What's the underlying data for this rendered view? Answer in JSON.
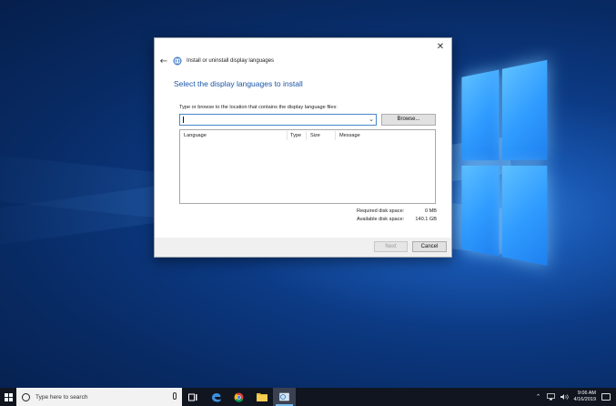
{
  "dialog": {
    "title": "Install or uninstall display languages",
    "heading": "Select the display languages to install",
    "path_label": "Type or browse to the location that contains the display language files:",
    "path_value": "",
    "browse_label": "Browse...",
    "columns": [
      "Language",
      "Type",
      "Size",
      "Message"
    ],
    "required_label": "Required disk space:",
    "required_value": "0 MB",
    "available_label": "Available disk space:",
    "available_value": "140.1 GB",
    "next_label": "Next",
    "cancel_label": "Cancel",
    "close_glyph": "✕",
    "back_glyph": "←"
  },
  "taskbar": {
    "search_placeholder": "Type here to search",
    "time": "9:06 AM",
    "date": "4/16/2019",
    "apps": [
      "task-view",
      "edge",
      "chrome",
      "file-explorer",
      "language-settings"
    ],
    "active_app": "language-settings"
  },
  "colors": {
    "accent": "#1a55a8",
    "taskbar": "#101520"
  }
}
